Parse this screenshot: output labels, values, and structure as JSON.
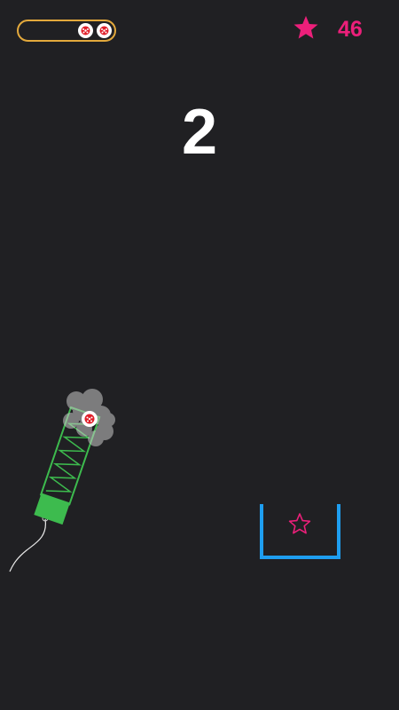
{
  "hud": {
    "ammo": {
      "balls_remaining": 2
    },
    "stars": {
      "icon": "star-icon",
      "count": "46",
      "color": "#ec1f7a"
    },
    "level": "2"
  },
  "game": {
    "launcher": {
      "color": "#3dbb4e",
      "loaded_ball": "red-dot-ball"
    },
    "goal_cup": {
      "color": "#1e9ef0",
      "target": "star-outline-icon",
      "target_color": "#ec1f7a"
    }
  }
}
